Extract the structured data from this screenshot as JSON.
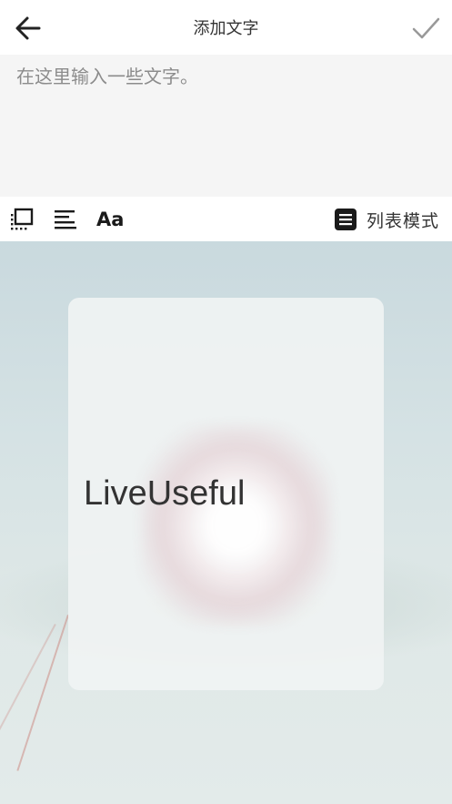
{
  "header": {
    "title": "添加文字"
  },
  "editor": {
    "placeholder": "在这里输入一些文字。",
    "value": ""
  },
  "toolbar": {
    "items": [
      {
        "icon": "text-frame-icon"
      },
      {
        "icon": "align-left-icon"
      },
      {
        "icon": "font-icon",
        "label": "Aa"
      }
    ],
    "list_mode_label": "列表模式",
    "list_mode_icon": "list-icon"
  },
  "preview": {
    "card_text": "LiveUseful"
  },
  "colors": {
    "header_bg": "#ffffff",
    "input_bg": "#f5f5f5",
    "text_primary": "#333333",
    "icon_dark": "#1a1a1a",
    "check_gray": "#999999"
  }
}
